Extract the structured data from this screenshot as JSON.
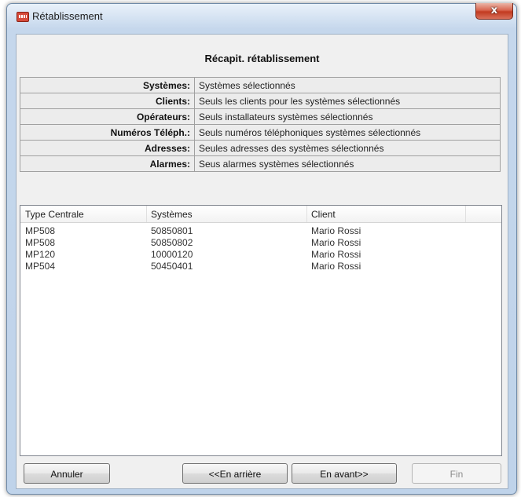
{
  "window": {
    "title": "Rétablissement",
    "close_label": "x"
  },
  "heading": "Récapit. rétablissement",
  "summary": [
    {
      "key": "Systèmes:",
      "value": "Systèmes sélectionnés"
    },
    {
      "key": "Clients:",
      "value": "Seuls les clients pour les systèmes sélectionnés"
    },
    {
      "key": "Opérateurs:",
      "value": "Seuls installateurs systèmes sélectionnés"
    },
    {
      "key": "Numéros Téléph.:",
      "value": "Seuls numéros téléphoniques systèmes sélectionnés"
    },
    {
      "key": "Adresses:",
      "value": "Seules adresses des systèmes sélectionnés"
    },
    {
      "key": "Alarmes:",
      "value": "Seus alarmes systèmes sélectionnés"
    }
  ],
  "list": {
    "columns": [
      "Type Centrale",
      "Systèmes",
      "Client"
    ],
    "rows": [
      [
        "MP508",
        "50850801",
        "Mario Rossi"
      ],
      [
        "MP508",
        "50850802",
        "Mario Rossi"
      ],
      [
        "MP120",
        "10000120",
        "Mario Rossi"
      ],
      [
        "MP504",
        "50450401",
        "Mario Rossi"
      ]
    ]
  },
  "buttons": {
    "cancel": "Annuler",
    "back": "<<En arrière",
    "next": "En avant>>",
    "finish": "Fin"
  }
}
